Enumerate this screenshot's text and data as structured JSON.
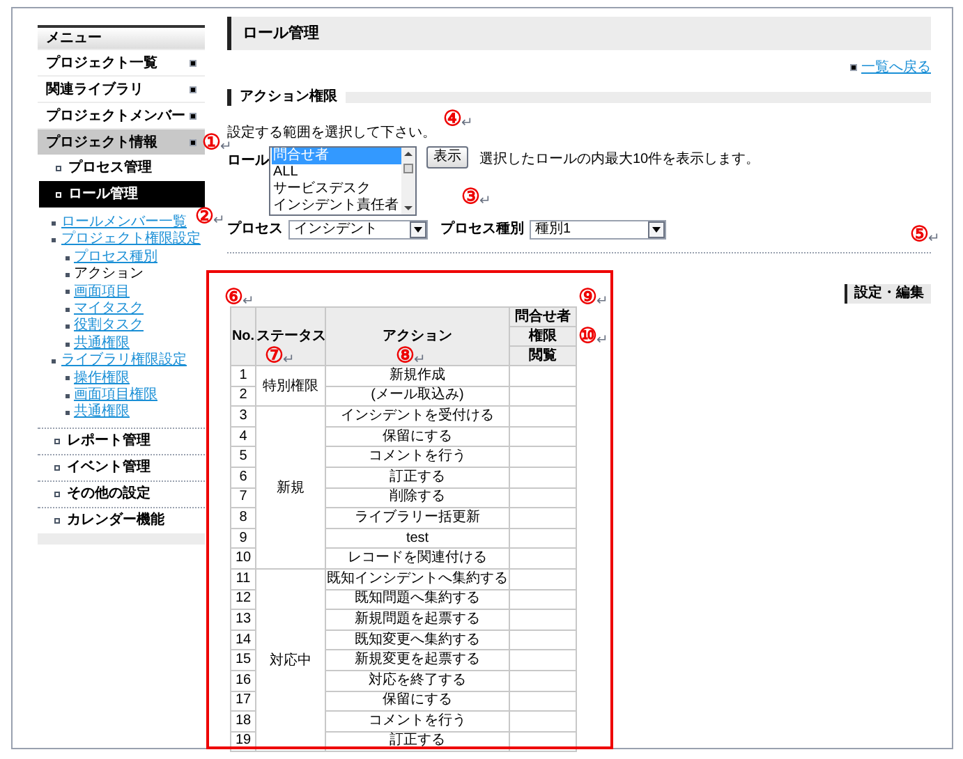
{
  "sidebar": {
    "title": "メニュー",
    "items": [
      {
        "label": "プロジェクト一覧",
        "selected": false
      },
      {
        "label": "関連ライブラリ",
        "selected": false
      },
      {
        "label": "プロジェクトメンバー",
        "selected": false
      },
      {
        "label": "プロジェクト情報",
        "selected": true
      }
    ],
    "sub_items": [
      {
        "label": "プロセス管理",
        "selected": false
      },
      {
        "label": "ロール管理",
        "selected": true
      }
    ],
    "links": [
      {
        "label": "ロールメンバー一覧",
        "link": true
      },
      {
        "label": "プロジェクト権限設定",
        "link": true,
        "children": [
          {
            "label": "プロセス種別",
            "link": true
          },
          {
            "label": "アクション",
            "link": false
          },
          {
            "label": "画面項目",
            "link": true
          },
          {
            "label": "マイタスク",
            "link": true
          },
          {
            "label": "役割タスク",
            "link": true
          },
          {
            "label": "共通権限",
            "link": true
          }
        ]
      },
      {
        "label": "ライブラリ権限設定",
        "link": true,
        "children": [
          {
            "label": "操作権限",
            "link": true
          },
          {
            "label": "画面項目権限",
            "link": true
          },
          {
            "label": "共通権限",
            "link": true
          }
        ]
      }
    ],
    "bottom_items": [
      "レポート管理",
      "イベント管理",
      "その他の設定",
      "カレンダー機能"
    ]
  },
  "page": {
    "title": "ロール管理",
    "back_link": "一覧へ戻る",
    "section": "アクション権限",
    "instruction": "設定する範囲を選択して下さい。",
    "role": {
      "label": "ロール",
      "options": [
        {
          "text": "問合せ者",
          "selected": true
        },
        {
          "text": "ALL",
          "selected": false
        },
        {
          "text": "サービスデスク",
          "selected": false
        },
        {
          "text": "インシデント責任者",
          "selected": false
        }
      ]
    },
    "show_button": "表示",
    "show_note": "選択したロールの内最大10件を表示します。",
    "process": {
      "label": "プロセス",
      "value": "インシデント"
    },
    "process_type": {
      "label": "プロセス種別",
      "value": "種別1"
    },
    "edit_button": "設定・編集"
  },
  "table": {
    "columns": {
      "no": "No.",
      "status": "ステータス",
      "action": "アクション",
      "role": "問合せ者",
      "permission": "権限",
      "view": "閲覧"
    },
    "groups": [
      {
        "status": "特別権限",
        "rows": [
          {
            "no": "1",
            "action": "新規作成"
          },
          {
            "no": "2",
            "action": "(メール取込み)"
          }
        ]
      },
      {
        "status": "新規",
        "rows": [
          {
            "no": "3",
            "action": "インシデントを受付ける"
          },
          {
            "no": "4",
            "action": "保留にする"
          },
          {
            "no": "5",
            "action": "コメントを行う"
          },
          {
            "no": "6",
            "action": "訂正する"
          },
          {
            "no": "7",
            "action": "削除する"
          },
          {
            "no": "8",
            "action": "ライブラリー括更新"
          },
          {
            "no": "9",
            "action": "test"
          },
          {
            "no": "10",
            "action": "レコードを関連付ける"
          }
        ]
      },
      {
        "status": "対応中",
        "rows": [
          {
            "no": "11",
            "action": "既知インシデントへ集約する"
          },
          {
            "no": "12",
            "action": "既知問題へ集約する"
          },
          {
            "no": "13",
            "action": "新規問題を起票する"
          },
          {
            "no": "14",
            "action": "既知変更へ集約する"
          },
          {
            "no": "15",
            "action": "新規変更を起票する"
          },
          {
            "no": "16",
            "action": "対応を終了する"
          },
          {
            "no": "17",
            "action": "保留にする"
          },
          {
            "no": "18",
            "action": "コメントを行う"
          },
          {
            "no": "19",
            "action": "訂正する"
          }
        ]
      }
    ]
  },
  "callouts": [
    {
      "label": "①",
      "mark": "↵"
    },
    {
      "label": "②",
      "mark": "↵"
    },
    {
      "label": "③",
      "mark": "↵"
    },
    {
      "label": "④",
      "mark": "↵"
    },
    {
      "label": "⑤",
      "mark": "↵"
    },
    {
      "label": "⑥",
      "mark": "↵"
    },
    {
      "label": "⑦",
      "mark": "↵"
    },
    {
      "label": "⑧",
      "mark": "↵"
    },
    {
      "label": "⑨",
      "mark": "↵"
    },
    {
      "label": "⑩",
      "mark": "↵"
    }
  ]
}
